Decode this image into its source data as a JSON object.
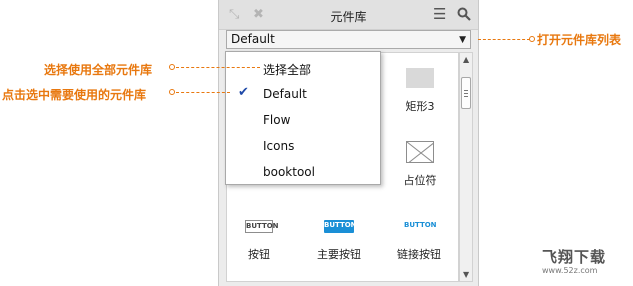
{
  "panel": {
    "title": "元件库",
    "select_value": "Default",
    "toolbar_icons": [
      "collapse-icon",
      "close-icon",
      "menu-icon",
      "search-icon"
    ]
  },
  "widgets": [
    {
      "label": "矩形3"
    },
    {
      "label": "占位符"
    },
    {
      "label": "按钮",
      "text": "BUTTON"
    },
    {
      "label": "主要按钮",
      "text": "BUTTON"
    },
    {
      "label": "链接按钮",
      "text": "BUTTON"
    }
  ],
  "dropdown": {
    "items": [
      "选择全部",
      "Default",
      "Flow",
      "Icons",
      "booktool"
    ],
    "checked_index": 1
  },
  "annotations": {
    "select_all": "选择使用全部元件库",
    "open_list": "打开元件库列表",
    "click_select": "点击选中需要使用的元件库"
  },
  "watermark": {
    "title": "飞翔下载",
    "url": "www.52z.com"
  },
  "colors": {
    "annotation": "#e8780f",
    "primary_button": "#1a8fd6",
    "link_button_text": "#1a8fd6",
    "check": "#1f4aa8"
  }
}
